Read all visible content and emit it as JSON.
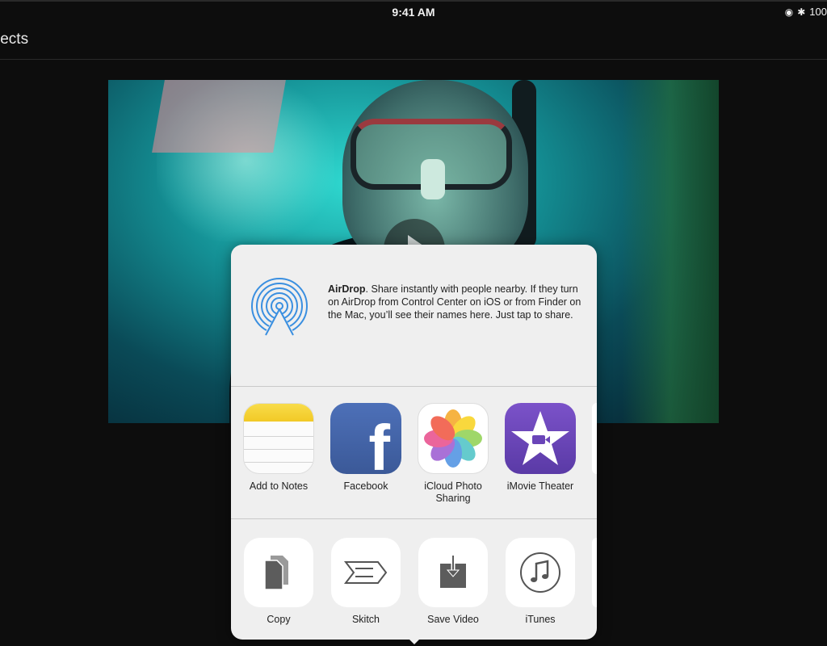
{
  "status_bar": {
    "time": "9:41 AM",
    "battery_text": "100"
  },
  "nav": {
    "title": "jects"
  },
  "airdrop": {
    "title": "AirDrop",
    "description": ". Share instantly with people nearby. If they turn on AirDrop from Control Center on iOS or from Finder on the Mac, you’ll see their names here. Just tap to share."
  },
  "share_apps": [
    {
      "label": "Add to Notes",
      "icon": "notes-icon"
    },
    {
      "label": "Facebook",
      "icon": "facebook-icon"
    },
    {
      "label": "iCloud Photo Sharing",
      "icon": "photos-icon"
    },
    {
      "label": "iMovie Theater",
      "icon": "imovie-icon"
    }
  ],
  "share_actions": [
    {
      "label": "Copy",
      "icon": "copy-icon"
    },
    {
      "label": "Skitch",
      "icon": "skitch-icon"
    },
    {
      "label": "Save Video",
      "icon": "save-video-icon"
    },
    {
      "label": "iTunes",
      "icon": "itunes-icon"
    }
  ],
  "colors": {
    "background": "#0d0d0d",
    "sheet": "#efefef",
    "airdrop_blue": "#3a8fe0",
    "facebook_blue": "#3b5998",
    "imovie_purple": "#6a45b8"
  }
}
